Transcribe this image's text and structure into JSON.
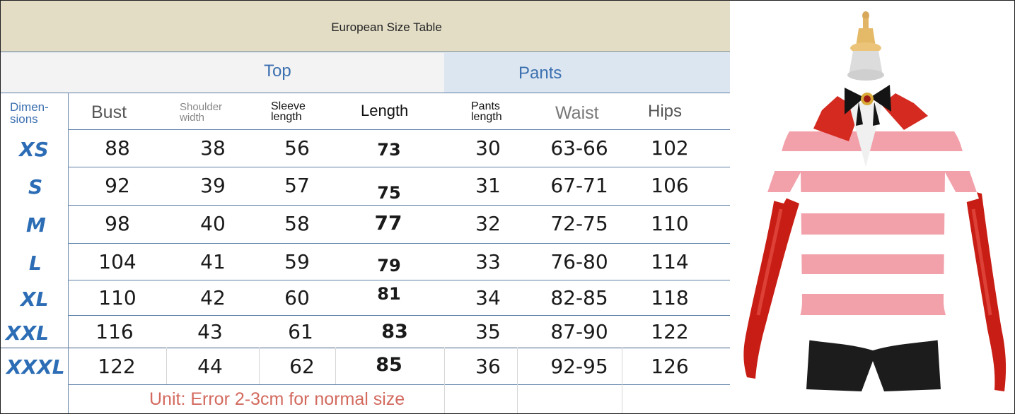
{
  "title": "European Size Table",
  "groups": {
    "top": "Top",
    "pants": "Pants"
  },
  "headers": {
    "dimensions": [
      "Dimen-",
      "sions"
    ],
    "bust": "Bust",
    "shoulder": [
      "Shoulder",
      "width"
    ],
    "sleeve": [
      "Sleeve",
      "length"
    ],
    "length": "Length",
    "pants_length": [
      "Pants",
      "length"
    ],
    "waist": "Waist",
    "hips": "Hips"
  },
  "rows": [
    {
      "size": "XS",
      "bust": "88",
      "shoulder": "38",
      "sleeve": "56",
      "length": "73",
      "pants_length": "30",
      "waist": "63-66",
      "hips": "102"
    },
    {
      "size": "S",
      "bust": "92",
      "shoulder": "39",
      "sleeve": "57",
      "length": "75",
      "pants_length": "31",
      "waist": "67-71",
      "hips": "106"
    },
    {
      "size": "M",
      "bust": "98",
      "shoulder": "40",
      "sleeve": "58",
      "length": "77",
      "pants_length": "32",
      "waist": "72-75",
      "hips": "110"
    },
    {
      "size": "L",
      "bust": "104",
      "shoulder": "41",
      "sleeve": "59",
      "length": "79",
      "pants_length": "33",
      "waist": "76-80",
      "hips": "114"
    },
    {
      "size": "XL",
      "bust": "110",
      "shoulder": "42",
      "sleeve": "60",
      "length": "81",
      "pants_length": "34",
      "waist": "82-85",
      "hips": "118"
    },
    {
      "size": "XXL",
      "bust": "116",
      "shoulder": "43",
      "sleeve": "61",
      "length": "83",
      "pants_length": "35",
      "waist": "87-90",
      "hips": "122"
    },
    {
      "size": "XXXL",
      "bust": "122",
      "shoulder": "44",
      "sleeve": "62",
      "length": "85",
      "pants_length": "36",
      "waist": "92-95",
      "hips": "126"
    }
  ],
  "note": "Unit: Error 2-3cm for normal size",
  "colors": {
    "title_band": "#e3ddc6",
    "pants_band": "#dce6f1",
    "group_label": "#3c70b0",
    "size_label": "#2c6db5",
    "note": "#d36a5e",
    "stripe_pink": "#f2a1ab",
    "jacket_red": "#d42a20"
  },
  "image": {
    "subject": "costume-on-mannequin"
  }
}
